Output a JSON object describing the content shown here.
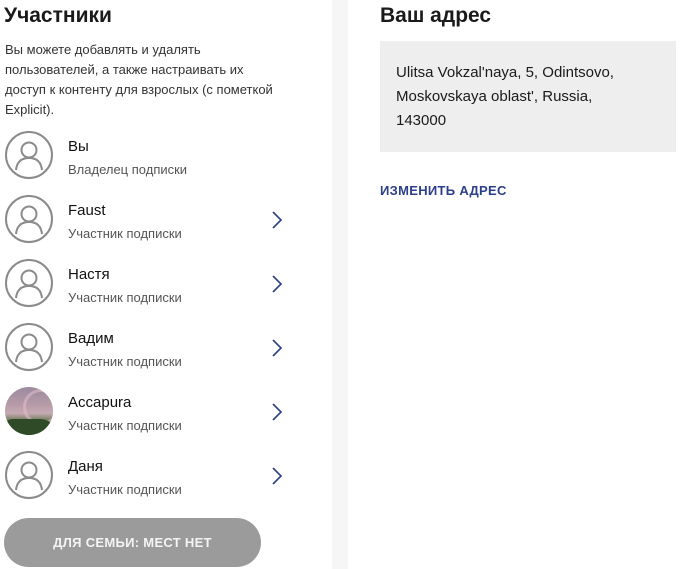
{
  "members_section": {
    "title": "Участники",
    "description": "Вы можете добавлять и удалять пользователей, а также настраивать их доступ к контенту для взрослых (с пометкой Explicit).",
    "members": [
      {
        "name": "Вы",
        "role": "Владелец подписки",
        "avatar": "person-placeholder-icon",
        "has_arrow": false
      },
      {
        "name": "Faust",
        "role": "Участник подписки",
        "avatar": "person-placeholder-icon",
        "has_arrow": true
      },
      {
        "name": "Настя",
        "role": "Участник подписки",
        "avatar": "person-placeholder-icon",
        "has_arrow": true
      },
      {
        "name": "Вадим",
        "role": "Участник подписки",
        "avatar": "person-placeholder-icon",
        "has_arrow": true
      },
      {
        "name": "Accapura",
        "role": "Участник подписки",
        "avatar": "photo",
        "has_arrow": true
      },
      {
        "name": "Даня",
        "role": "Участник подписки",
        "avatar": "person-placeholder-icon",
        "has_arrow": true
      }
    ],
    "family_button_label": "ДЛЯ СЕМЬИ: МЕСТ НЕТ"
  },
  "address_section": {
    "title": "Ваш адрес",
    "address_lines": [
      "Ulitsa Vokzal'naya, 5, Odintsovo,",
      "Moskovskaya oblast', Russia,",
      "143000"
    ],
    "change_link_label": "ИЗМЕНИТЬ АДРЕС"
  },
  "colors": {
    "link": "#2d3f8c",
    "chevron": "#2d3f8c",
    "button_disabled": "#9b9b9b",
    "address_box": "#eeeeee"
  }
}
